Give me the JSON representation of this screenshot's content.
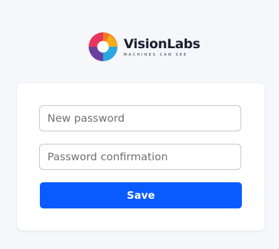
{
  "logo": {
    "brand_name": "VisionLabs",
    "tagline": "MACHINES CAN SEE",
    "icon": "visionlabs-logo-icon"
  },
  "form": {
    "new_password_placeholder": "New password",
    "confirm_password_placeholder": "Password confirmation",
    "save_label": "Save"
  },
  "colors": {
    "background": "#f5f7fa",
    "card": "#ffffff",
    "primary_button": "#0a5bff",
    "input_border": "#bfc3cc",
    "brand_text": "#1c1f2e"
  }
}
